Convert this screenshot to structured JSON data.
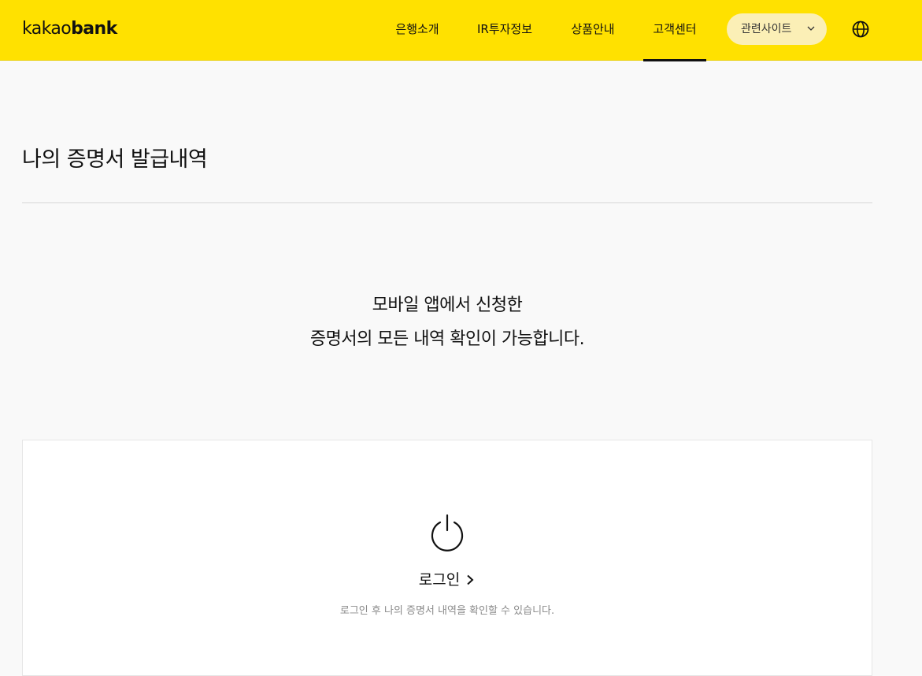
{
  "header": {
    "logo_light": "kakao",
    "logo_bold": "bank",
    "nav": [
      {
        "label": "은행소개"
      },
      {
        "label": "IR투자정보"
      },
      {
        "label": "상품안내"
      },
      {
        "label": "고객센터"
      }
    ],
    "active_nav": "고객센터",
    "related_sites_label": "관련사이트",
    "globe_icon": "globe-icon"
  },
  "main": {
    "title": "나의 증명서 발급내역",
    "notice_line1": "모바일 앱에서 신청한",
    "notice_line2": "증명서의 모든 내역 확인이 가능합니다."
  },
  "login_card": {
    "icon": "power-icon",
    "login_label": "로그인",
    "description": "로그인 후 나의 증명서 내역을 확인할 수 있습니다."
  },
  "colors": {
    "brand_yellow": "#ffe100",
    "related_btn_bg": "#fbefb6",
    "text": "#111111",
    "muted_text": "#8a8a8a",
    "page_bg": "#f9f9f9"
  }
}
